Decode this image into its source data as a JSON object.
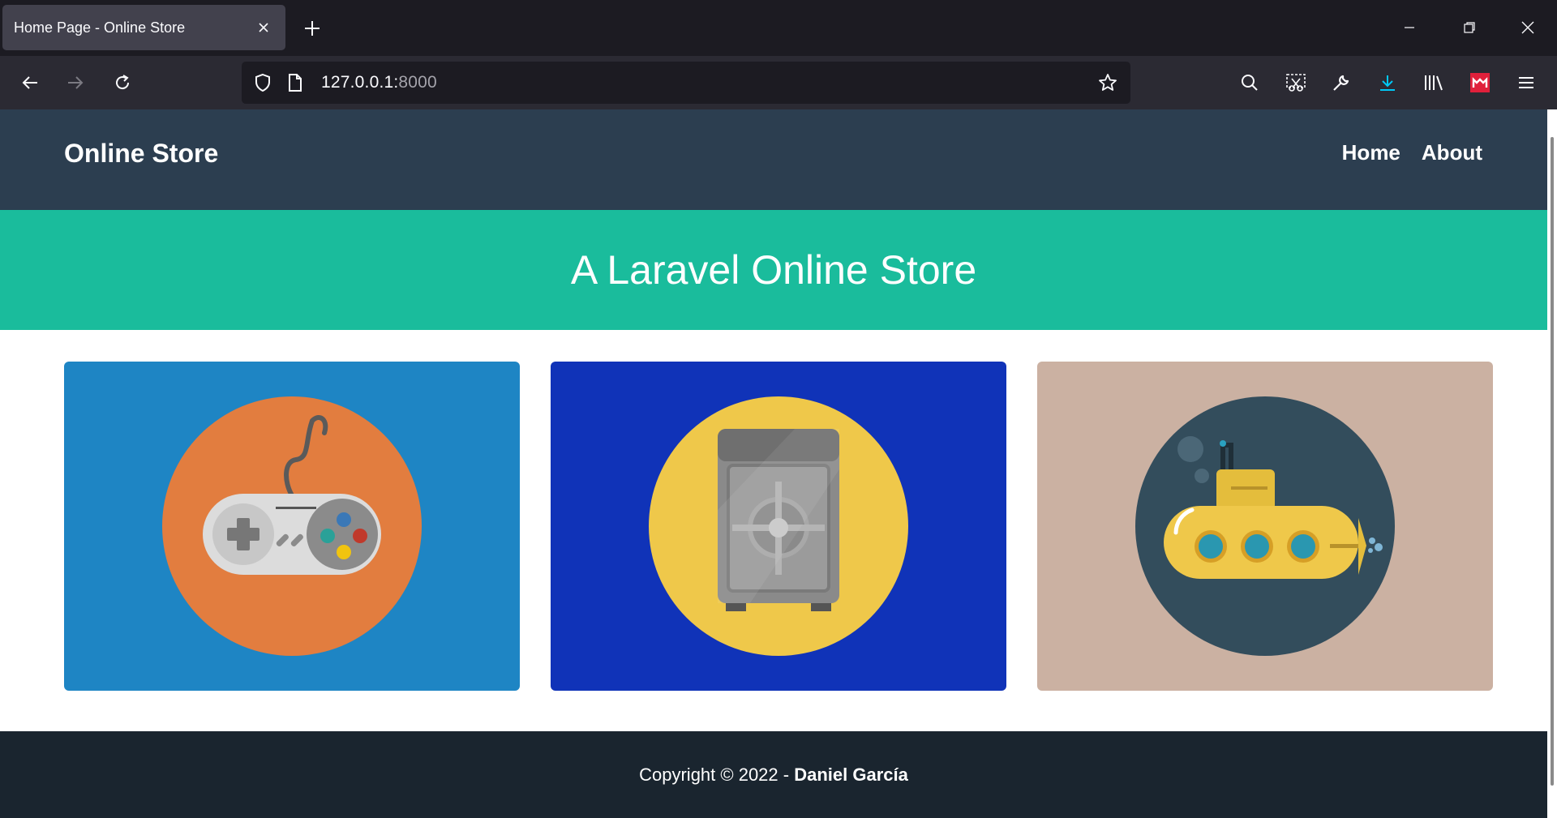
{
  "browser": {
    "tab_title": "Home Page - Online Store",
    "url_host": "127.0.0.1:",
    "url_port": "8000"
  },
  "site": {
    "brand": "Online Store",
    "nav": [
      {
        "label": "Home"
      },
      {
        "label": "About"
      }
    ],
    "hero_title": "A Laravel Online Store",
    "cards": [
      {
        "image": "game-controller-icon",
        "bg": "#1e85c4",
        "circle": "#e27d3f"
      },
      {
        "image": "safe-icon",
        "bg": "#1033b8",
        "circle": "#efc84a"
      },
      {
        "image": "submarine-icon",
        "bg": "#cbb1a2",
        "circle": "#334d5c"
      }
    ],
    "footer": {
      "prefix": "Copyright © 2022 - ",
      "author": "Daniel García"
    }
  }
}
